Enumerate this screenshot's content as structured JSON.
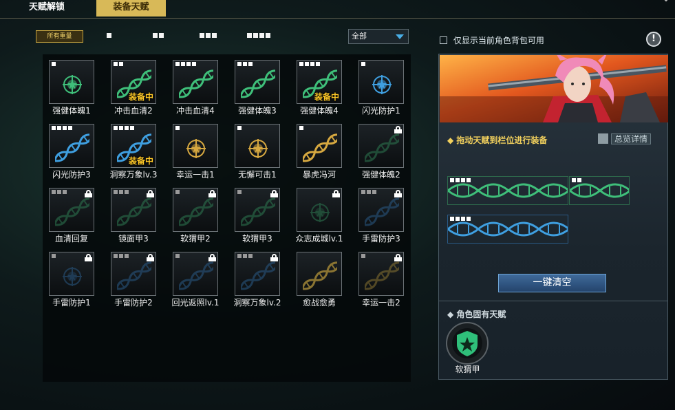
{
  "tabs": [
    {
      "label": "天赋解锁"
    },
    {
      "label": "装备天赋"
    }
  ],
  "filters": {
    "all_weights": "所有重量",
    "dropdown_value": "全部"
  },
  "equipped_label": "装备中",
  "cards": [
    {
      "name": "强健体魄1",
      "weight": 1,
      "art": "medal",
      "color": "#3fbf7a",
      "equipped": false,
      "locked": false
    },
    {
      "name": "冲击血清2",
      "weight": 2,
      "art": "dna",
      "color": "#3fbf7a",
      "equipped": true,
      "locked": false
    },
    {
      "name": "冲击血清4",
      "weight": 4,
      "art": "dna",
      "color": "#3fbf7a",
      "equipped": false,
      "locked": false
    },
    {
      "name": "强健体魄3",
      "weight": 3,
      "art": "dna",
      "color": "#3fbf7a",
      "equipped": false,
      "locked": false
    },
    {
      "name": "强健体魄4",
      "weight": 4,
      "art": "dna",
      "color": "#3fbf7a",
      "equipped": true,
      "locked": false
    },
    {
      "name": "闪光防护1",
      "weight": 1,
      "art": "medal",
      "color": "#3f9fe0",
      "equipped": false,
      "locked": false
    },
    {
      "name": "闪光防护3",
      "weight": 4,
      "art": "dna",
      "color": "#3f9fe0",
      "equipped": false,
      "locked": false
    },
    {
      "name": "洞察万象lv.3",
      "weight": 4,
      "art": "dna",
      "color": "#3f9fe0",
      "equipped": true,
      "locked": false
    },
    {
      "name": "幸运一击1",
      "weight": 1,
      "art": "medal",
      "color": "#d6a840",
      "equipped": false,
      "locked": false
    },
    {
      "name": "无懈可击1",
      "weight": 1,
      "art": "medal",
      "color": "#d6a840",
      "equipped": false,
      "locked": false
    },
    {
      "name": "暴虎冯河",
      "weight": 1,
      "art": "dna",
      "color": "#d6a840",
      "equipped": false,
      "locked": false
    },
    {
      "name": "强健体魄2",
      "weight": 0,
      "art": "dna",
      "color": "#2e7a52",
      "equipped": false,
      "locked": true
    },
    {
      "name": "血清回复",
      "weight": 3,
      "art": "dna",
      "color": "#2e7a52",
      "equipped": false,
      "locked": true
    },
    {
      "name": "镜面甲3",
      "weight": 3,
      "art": "dna",
      "color": "#2e7a52",
      "equipped": false,
      "locked": true
    },
    {
      "name": "软猬甲2",
      "weight": 1,
      "art": "dna",
      "color": "#2e7a52",
      "equipped": false,
      "locked": true
    },
    {
      "name": "软猬甲3",
      "weight": 1,
      "art": "dna",
      "color": "#2e7a52",
      "equipped": false,
      "locked": true
    },
    {
      "name": "众志成城lv.1",
      "weight": 0,
      "art": "medal",
      "color": "#2e7a52",
      "equipped": false,
      "locked": true
    },
    {
      "name": "手雷防护3",
      "weight": 3,
      "art": "dna",
      "color": "#2a5a86",
      "equipped": false,
      "locked": true
    },
    {
      "name": "手雷防护1",
      "weight": 1,
      "art": "medal",
      "color": "#2a5a86",
      "equipped": false,
      "locked": true
    },
    {
      "name": "手雷防护2",
      "weight": 3,
      "art": "dna",
      "color": "#2a5a86",
      "equipped": false,
      "locked": true
    },
    {
      "name": "回光返照lv.1",
      "weight": 1,
      "art": "dna",
      "color": "#2a5a86",
      "equipped": false,
      "locked": true
    },
    {
      "name": "洞察万象lv.2",
      "weight": 3,
      "art": "dna",
      "color": "#2a5a86",
      "equipped": false,
      "locked": true
    },
    {
      "name": "愈战愈勇",
      "weight": 0,
      "art": "dna",
      "color": "#8a7432",
      "equipped": false,
      "locked": false
    },
    {
      "name": "幸运一击2",
      "weight": 1,
      "art": "dna",
      "color": "#8a7432",
      "equipped": false,
      "locked": true
    }
  ],
  "right": {
    "only_bag_label": "仅显示当前角色背包可用",
    "drag_hint": "拖动天赋到栏位进行装备",
    "overview_label": "总览详情",
    "clear_label": "一键清空",
    "innate_title": "角色固有天赋",
    "innate_name": "软猬甲",
    "slots": [
      {
        "weight": 4,
        "color": "#3fbf7a"
      },
      {
        "weight": 2,
        "color": "#3fbf7a"
      },
      {
        "weight": 4,
        "color": "#3f9fe0"
      }
    ]
  },
  "colors": {
    "gold": "#d8b958",
    "equipped": "#ffc928",
    "blue_button": "#2f5684"
  }
}
